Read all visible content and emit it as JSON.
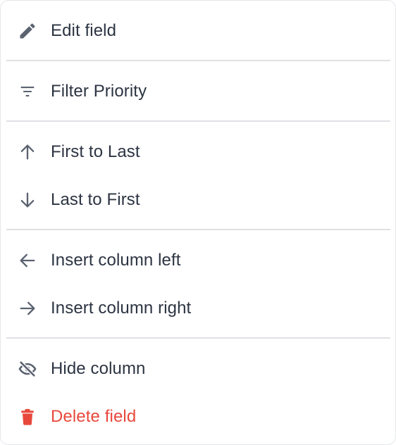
{
  "menu": {
    "edit_field": {
      "label": "Edit field",
      "icon": "pencil-icon"
    },
    "filter_priority": {
      "label": "Filter Priority",
      "icon": "filter-icon"
    },
    "first_to_last": {
      "label": "First to Last",
      "icon": "arrow-up-icon"
    },
    "last_to_first": {
      "label": "Last to First",
      "icon": "arrow-down-icon"
    },
    "insert_left": {
      "label": "Insert column left",
      "icon": "arrow-left-icon"
    },
    "insert_right": {
      "label": "Insert column right",
      "icon": "arrow-right-icon"
    },
    "hide_column": {
      "label": "Hide column",
      "icon": "eye-off-icon"
    },
    "delete_field": {
      "label": "Delete field",
      "icon": "trash-icon"
    }
  },
  "colors": {
    "text": "#2c3442",
    "icon": "#5b6270",
    "danger": "#e8483c",
    "divider": "#e0e1e5"
  }
}
